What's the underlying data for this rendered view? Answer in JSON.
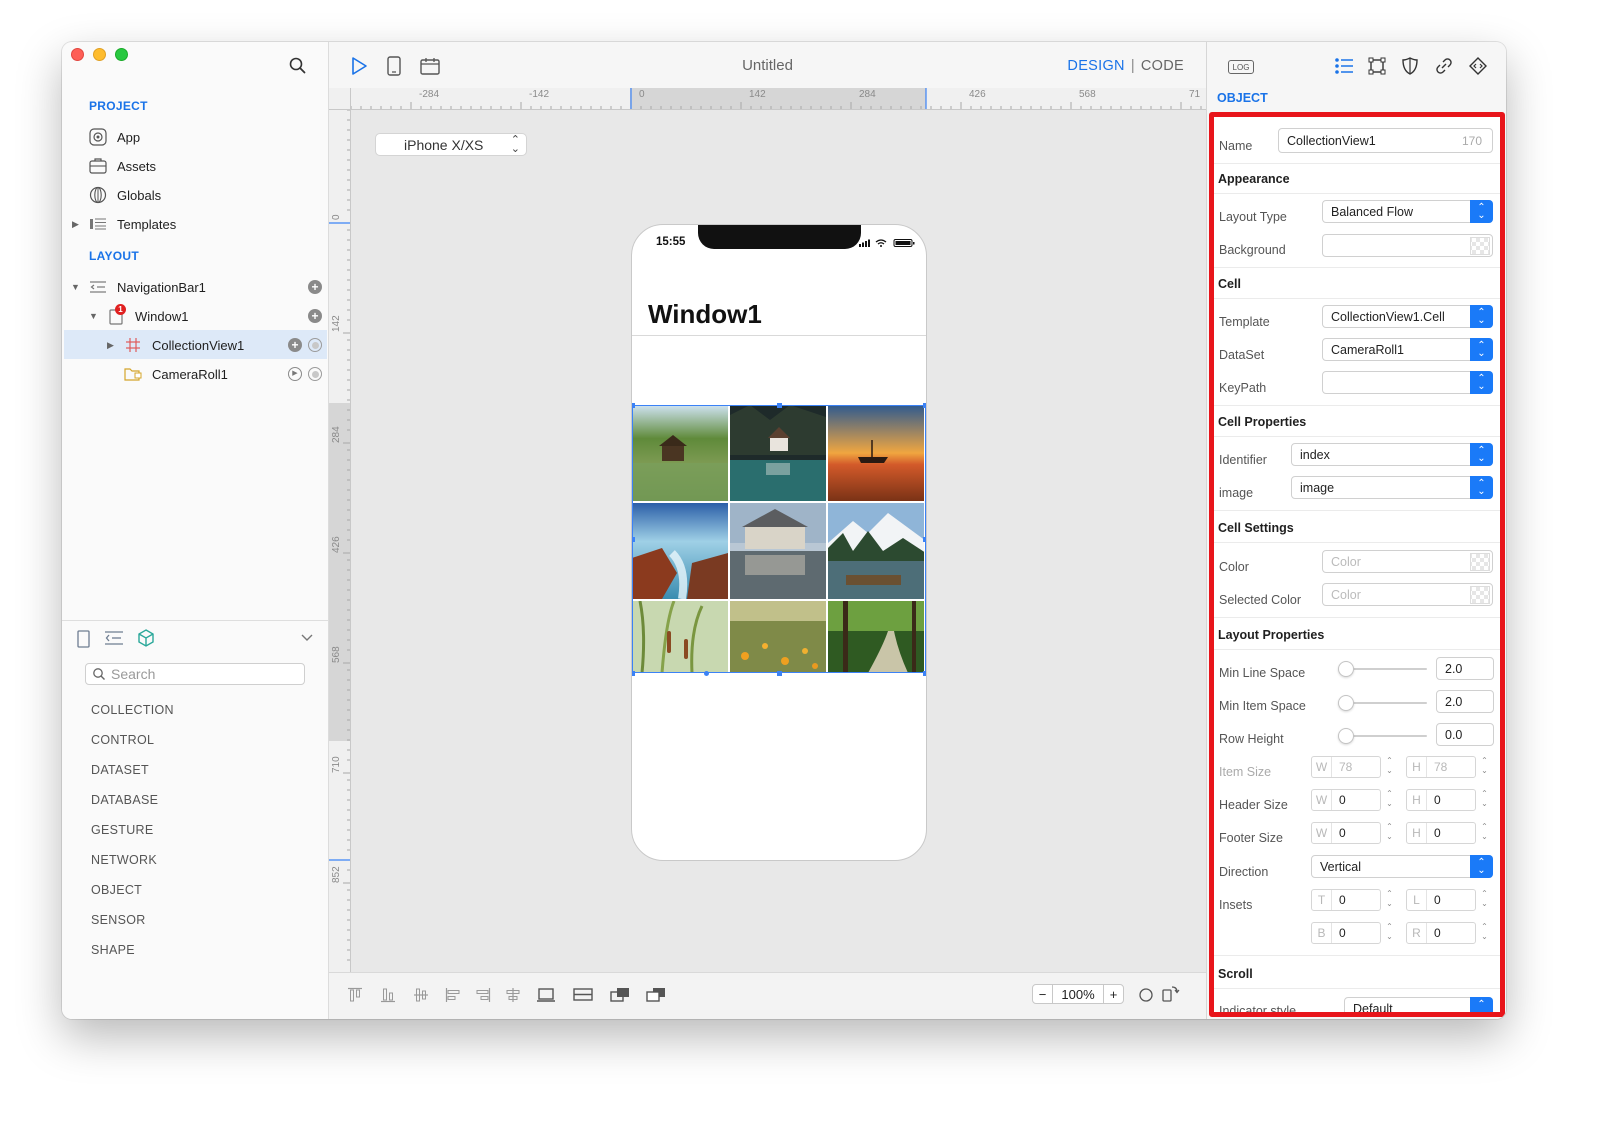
{
  "project_section": {
    "title": "PROJECT",
    "items": [
      {
        "label": "App",
        "icon": "app-icon"
      },
      {
        "label": "Assets",
        "icon": "assets-icon"
      },
      {
        "label": "Globals",
        "icon": "globe-icon"
      },
      {
        "label": "Templates",
        "icon": "templates-icon"
      }
    ]
  },
  "layout_section": {
    "title": "LAYOUT",
    "items": [
      {
        "label": "NavigationBar1",
        "icon": "navigation-bar-icon"
      },
      {
        "label": "Window1",
        "icon": "window-icon",
        "badge": "1"
      },
      {
        "label": "CollectionView1",
        "icon": "grid-icon",
        "selected": true
      },
      {
        "label": "CameraRoll1",
        "icon": "folder-icon"
      }
    ]
  },
  "library": {
    "search_placeholder": "Search",
    "categories": [
      "COLLECTION",
      "CONTROL",
      "DATASET",
      "DATABASE",
      "GESTURE",
      "NETWORK",
      "OBJECT",
      "SENSOR",
      "SHAPE"
    ]
  },
  "toolbar": {
    "title": "Untitled",
    "mode_design": "DESIGN",
    "mode_separator": "|",
    "mode_code": "CODE"
  },
  "rulers": {
    "horizontal": [
      "-284",
      "-142",
      "0",
      "142",
      "284",
      "426",
      "568",
      "71"
    ],
    "vertical": [
      "0",
      "142",
      "284",
      "426",
      "568",
      "710",
      "852"
    ]
  },
  "canvas": {
    "device": "iPhone X/XS",
    "status_time": "15:55",
    "window_title": "Window1",
    "zoom_minus": "−",
    "zoom_level": "100%",
    "zoom_plus": "+"
  },
  "inspector": {
    "log_button": "LOG",
    "section": "OBJECT",
    "name_label": "Name",
    "name_value": "CollectionView1",
    "name_count": "170",
    "appearance": "Appearance",
    "layout_type_label": "Layout Type",
    "layout_type_value": "Balanced Flow",
    "background_label": "Background",
    "cell": "Cell",
    "template_label": "Template",
    "template_value": "CollectionView1.Cell",
    "dataset_label": "DataSet",
    "dataset_value": "CameraRoll1",
    "keypath_label": "KeyPath",
    "cell_properties": "Cell Properties",
    "identifier_label": "Identifier",
    "identifier_value": "index",
    "image_label": "image",
    "image_value": "image",
    "cell_settings": "Cell Settings",
    "color_label": "Color",
    "color_placeholder": "Color",
    "selected_color_label": "Selected Color",
    "selected_color_placeholder": "Color",
    "layout_properties": "Layout Properties",
    "min_line_space_label": "Min Line Space",
    "min_line_space_value": "2.0",
    "min_item_space_label": "Min Item Space",
    "min_item_space_value": "2.0",
    "row_height_label": "Row Height",
    "row_height_value": "0.0",
    "item_size_label": "Item Size",
    "item_size_w": "78",
    "item_size_h": "78",
    "header_size_label": "Header Size",
    "header_size_w": "0",
    "header_size_h": "0",
    "footer_size_label": "Footer Size",
    "footer_size_w": "0",
    "footer_size_h": "0",
    "direction_label": "Direction",
    "direction_value": "Vertical",
    "insets_label": "Insets",
    "inset_t": "0",
    "inset_l": "0",
    "inset_b": "0",
    "inset_r": "0",
    "prefix_w": "W",
    "prefix_h": "H",
    "prefix_t": "T",
    "prefix_l": "L",
    "prefix_b": "B",
    "prefix_r": "R",
    "scroll": "Scroll",
    "indicator_style_label": "Indicator style",
    "indicator_style_value": "Default"
  },
  "colors": {
    "accent": "#1a73e8",
    "popup_blue": "#1a7af8",
    "highlight_frame": "#e8151b",
    "selection_row": "#dde9f8"
  }
}
